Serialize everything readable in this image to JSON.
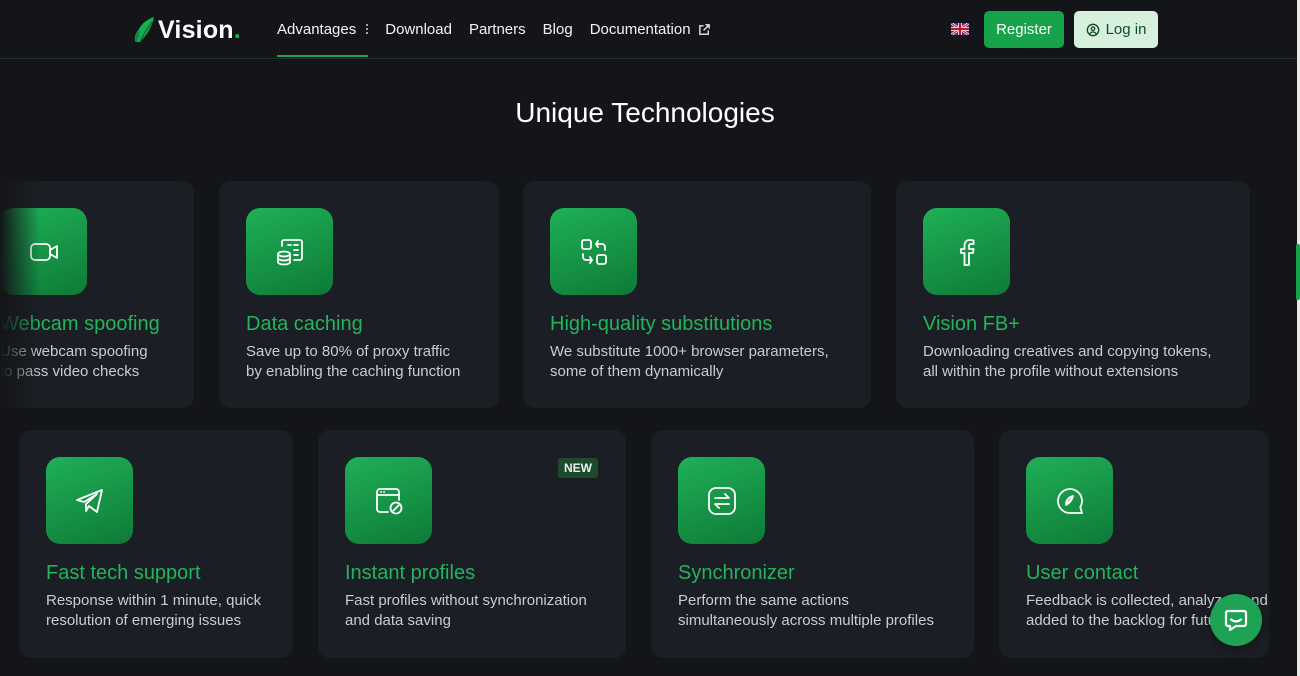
{
  "header": {
    "logo_text": "Vision",
    "logo_dot": ".",
    "nav": [
      {
        "label": "Advantages",
        "active": true
      },
      {
        "label": "Download"
      },
      {
        "label": "Partners"
      },
      {
        "label": "Blog"
      },
      {
        "label": "Documentation"
      }
    ],
    "language_flag": "uk-flag-icon",
    "register_label": "Register",
    "login_label": "Log in"
  },
  "section": {
    "title": "Unique Technologies"
  },
  "cards_row1": [
    {
      "title": "Webcam spoofing",
      "desc": "Use webcam spoofing\nto pass video checks",
      "icon": "video-camera-icon"
    },
    {
      "title": "Data caching",
      "desc": "Save up to 80% of proxy traffic\nby enabling the caching function",
      "icon": "database-icon"
    },
    {
      "title": "High-quality substitutions",
      "desc": "We substitute 1000+ browser parameters,\nsome of them dynamically",
      "icon": "swap-icon"
    },
    {
      "title": "Vision FB+",
      "desc": "Downloading creatives and copying tokens,\nall within the profile without extensions",
      "icon": "facebook-icon"
    }
  ],
  "cards_row2": [
    {
      "title": "Fast tech support",
      "desc": "Response within 1 minute, quick\nresolution of emerging issues",
      "icon": "telegram-icon"
    },
    {
      "title": "Instant profiles",
      "desc": "Fast profiles without synchronization\nand data saving",
      "icon": "instant-profile-icon",
      "badge": "NEW"
    },
    {
      "title": "Synchronizer",
      "desc": "Perform the same actions\nsimultaneously across multiple profiles",
      "icon": "sync-icon"
    },
    {
      "title": "User contact",
      "desc": "Feedback is collected, analyzed and\nadded to the backlog for future",
      "icon": "feedback-icon"
    }
  ],
  "colors": {
    "accent": "#17a34a",
    "card_title": "#23b45c",
    "background": "#131519",
    "card_bg": "#1b1e24"
  }
}
